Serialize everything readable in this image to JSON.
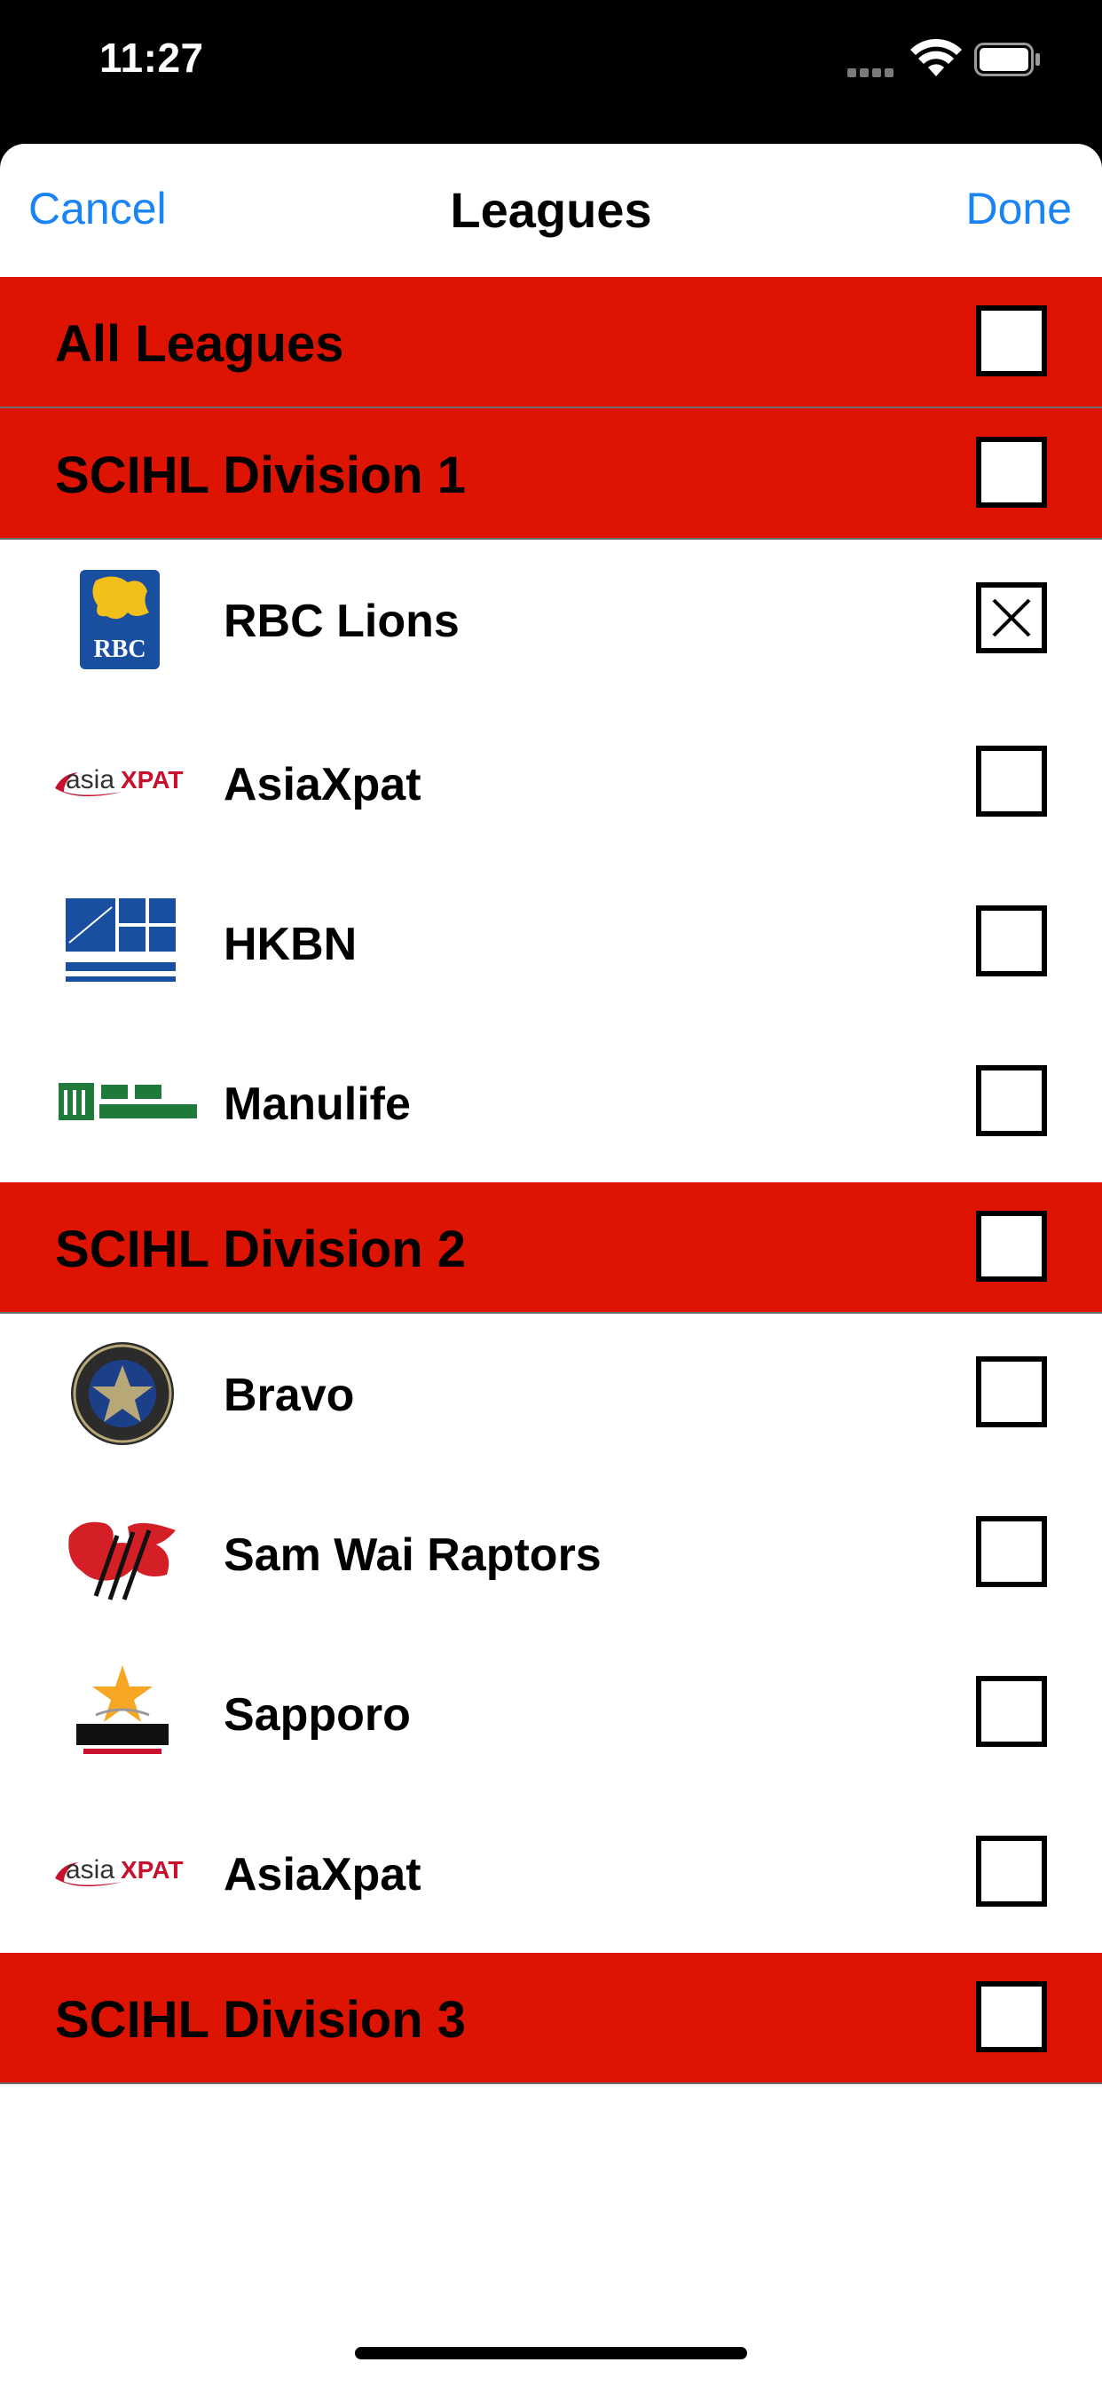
{
  "status_bar": {
    "time": "11:27"
  },
  "nav": {
    "cancel_label": "Cancel",
    "title": "Leagues",
    "done_label": "Done"
  },
  "rows": [
    {
      "type": "league",
      "label": "All Leagues",
      "checked": false
    },
    {
      "type": "league",
      "label": "SCIHL Division 1",
      "checked": false
    },
    {
      "type": "team",
      "label": "RBC Lions",
      "logo": "rbc-logo",
      "checked": true
    },
    {
      "type": "team",
      "label": "AsiaXpat",
      "logo": "asiaxpat-logo",
      "checked": false
    },
    {
      "type": "team",
      "label": "HKBN",
      "logo": "hkbn-logo",
      "checked": false
    },
    {
      "type": "team",
      "label": "Manulife",
      "logo": "manulife-logo",
      "checked": false
    },
    {
      "type": "league",
      "label": "SCIHL Division 2",
      "checked": false
    },
    {
      "type": "team",
      "label": "Bravo",
      "logo": "bravo-logo",
      "checked": false
    },
    {
      "type": "team",
      "label": "Sam Wai Raptors",
      "logo": "sam-wai-raptors-logo",
      "checked": false
    },
    {
      "type": "team",
      "label": "Sapporo",
      "logo": "sapporo-logo",
      "checked": false
    },
    {
      "type": "team",
      "label": "AsiaXpat",
      "logo": "asiaxpat-logo",
      "checked": false
    },
    {
      "type": "league",
      "label": "SCIHL Division 3",
      "checked": false
    }
  ],
  "colors": {
    "league_row_bg": "#dc1401",
    "nav_button": "#1a84f5"
  }
}
